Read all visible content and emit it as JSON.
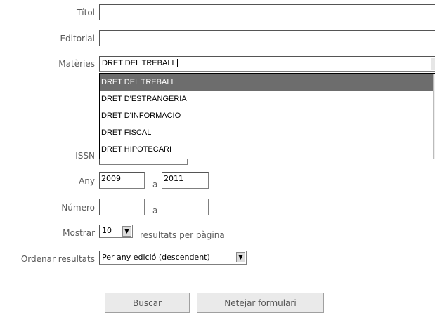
{
  "form": {
    "titol_label": "Títol",
    "titol_value": "",
    "editorial_label": "Editorial",
    "editorial_value": "",
    "materies_label": "Matèries",
    "materies_value": "DRET DEL TREBALL",
    "materies_options": [
      "DRET DEL TREBALL",
      "DRET D'ESTRANGERIA",
      "DRET D'INFORMACIO",
      "DRET FISCAL",
      "DRET HIPOTECARI"
    ],
    "issn_label": "ISSN",
    "issn_value": "",
    "any_label": "Any",
    "any_from": "2009",
    "any_sep": "a",
    "any_to": "2011",
    "numero_label": "Número",
    "numero_from": "",
    "numero_sep": "a",
    "numero_to": "",
    "mostrar_label": "Mostrar",
    "mostrar_value": "10",
    "mostrar_suffix": "resultats per pàgina",
    "ordenar_label": "Ordenar resultats",
    "ordenar_value": "Per any edició (descendent)"
  },
  "buttons": {
    "buscar": "Buscar",
    "netejar": "Netejar formulari"
  }
}
